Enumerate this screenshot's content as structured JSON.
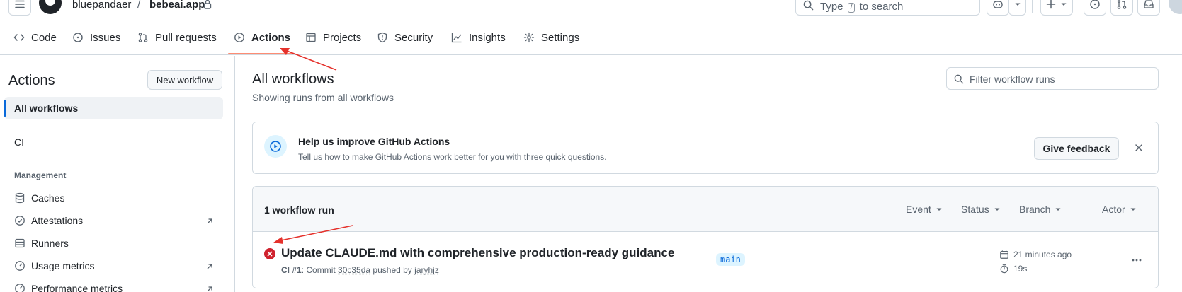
{
  "header": {
    "owner": "bluepandaer",
    "separator": "/",
    "repo": "bebeai.app",
    "search_prefix": "Type",
    "search_key": "/",
    "search_suffix": "to search"
  },
  "repo_nav": {
    "tabs": [
      {
        "label": "Code",
        "icon": "code-icon"
      },
      {
        "label": "Issues",
        "icon": "issue-icon"
      },
      {
        "label": "Pull requests",
        "icon": "pull-request-icon"
      },
      {
        "label": "Actions",
        "icon": "play-icon",
        "active": true
      },
      {
        "label": "Projects",
        "icon": "table-icon"
      },
      {
        "label": "Security",
        "icon": "shield-icon"
      },
      {
        "label": "Insights",
        "icon": "graph-icon"
      },
      {
        "label": "Settings",
        "icon": "gear-icon"
      }
    ]
  },
  "sidebar": {
    "title": "Actions",
    "new_workflow": "New workflow",
    "all_workflows": "All workflows",
    "workflows": [
      "CI"
    ],
    "management_label": "Management",
    "management": [
      {
        "label": "Caches",
        "icon": "database-icon"
      },
      {
        "label": "Attestations",
        "icon": "verified-icon",
        "external": true
      },
      {
        "label": "Runners",
        "icon": "server-icon"
      },
      {
        "label": "Usage metrics",
        "icon": "meter-icon",
        "external": true
      },
      {
        "label": "Performance metrics",
        "icon": "meter-icon",
        "external": true
      }
    ]
  },
  "main": {
    "title": "All workflows",
    "subtitle": "Showing runs from all workflows",
    "filter_placeholder": "Filter workflow runs"
  },
  "banner": {
    "title": "Help us improve GitHub Actions",
    "text": "Tell us how to make GitHub Actions work better for you with three quick questions.",
    "feedback_button": "Give feedback"
  },
  "runs": {
    "count_label": "1 workflow run",
    "filters": [
      "Event",
      "Status",
      "Branch",
      "Actor"
    ],
    "items": [
      {
        "title": "Update CLAUDE.md with comprehensive production-ready guidance",
        "workflow": "CI #1",
        "commit_prefix": ": Commit",
        "commit": "30c35da",
        "pushed_by": "pushed by",
        "actor": "jaryhjz",
        "branch": "main",
        "time": "21 minutes ago",
        "duration": "19s",
        "status": "failure"
      }
    ]
  },
  "colors": {
    "accent": "#0969da",
    "failure": "#cf222e",
    "tab_underline": "#fd8c73",
    "annotation_arrow": "#e5312b"
  }
}
